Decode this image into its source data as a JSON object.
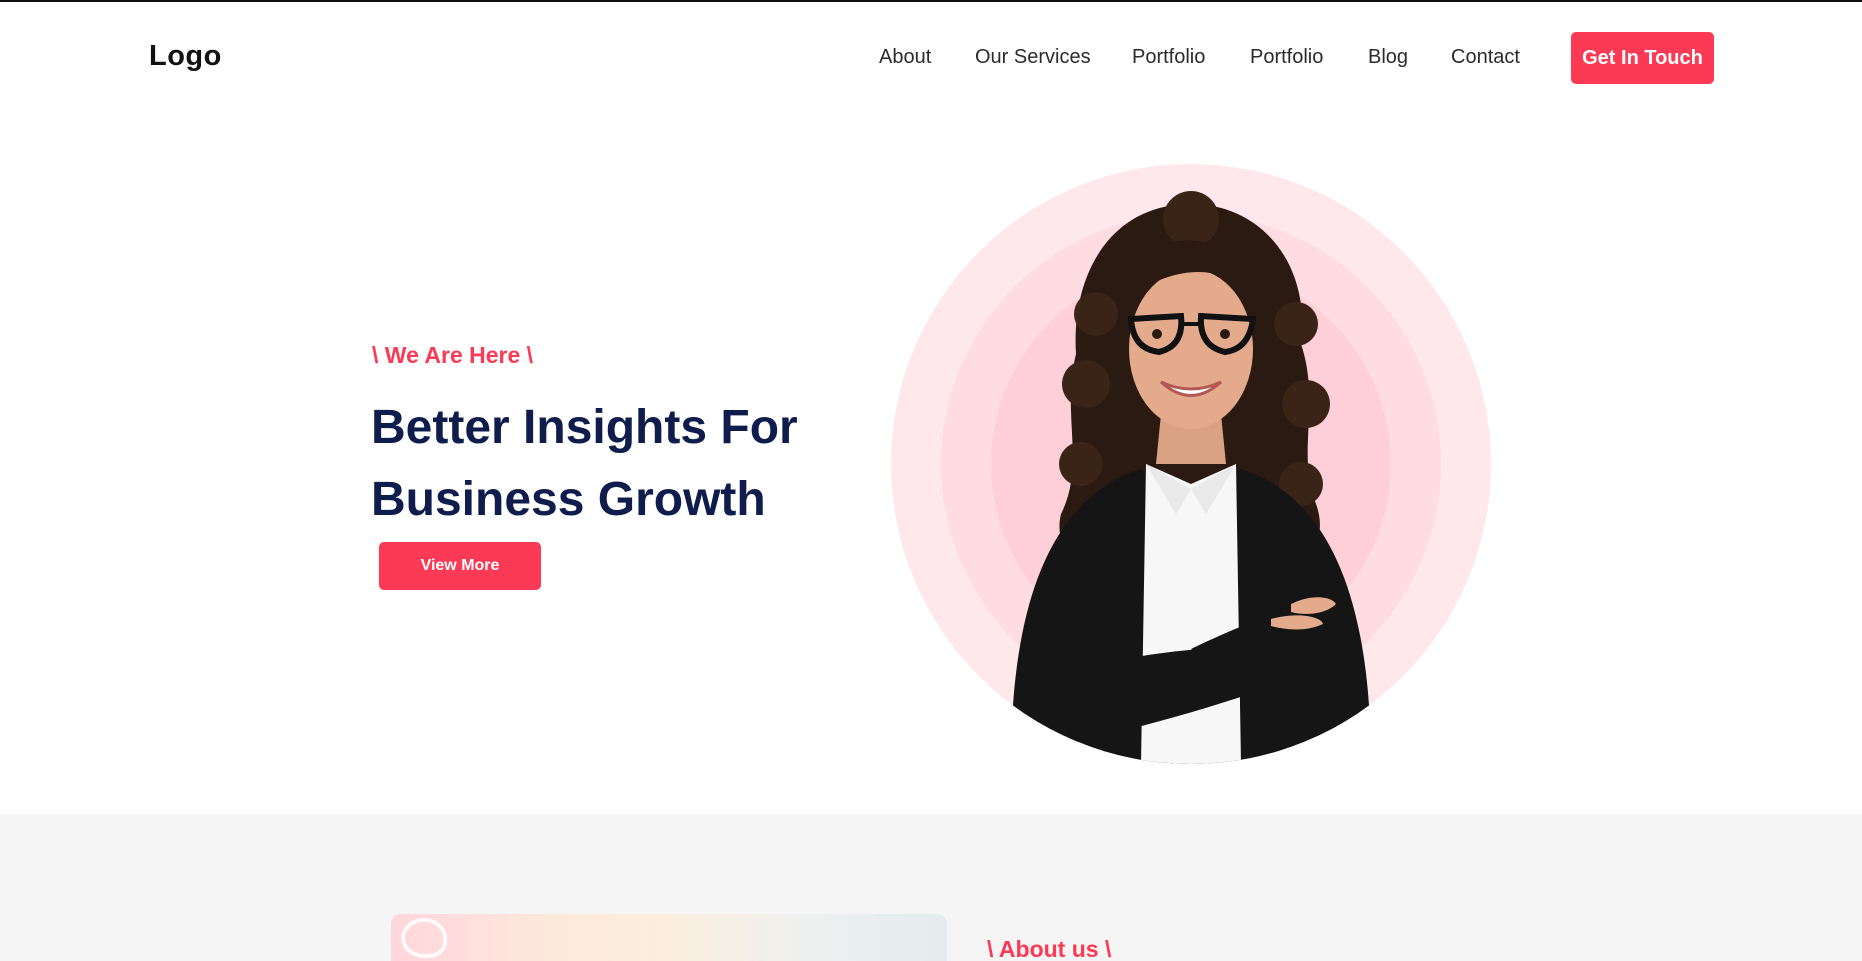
{
  "header": {
    "logo": "Logo",
    "nav": [
      {
        "label": "About"
      },
      {
        "label": "Our Services"
      },
      {
        "label": "Portfolio"
      },
      {
        "label": "Portfolio"
      },
      {
        "label": "Blog"
      },
      {
        "label": "Contact"
      }
    ],
    "cta_label": "Get In Touch"
  },
  "hero": {
    "eyebrow": "\\ We Are Here \\",
    "headline_line1": "Better Insights For",
    "headline_line2": "Business Growth",
    "button_label": "View More"
  },
  "about": {
    "title": "\\ About us \\"
  },
  "colors": {
    "accent": "#fc3a55",
    "heading": "#0f1d4d",
    "section_bg": "#f5f5f5"
  }
}
